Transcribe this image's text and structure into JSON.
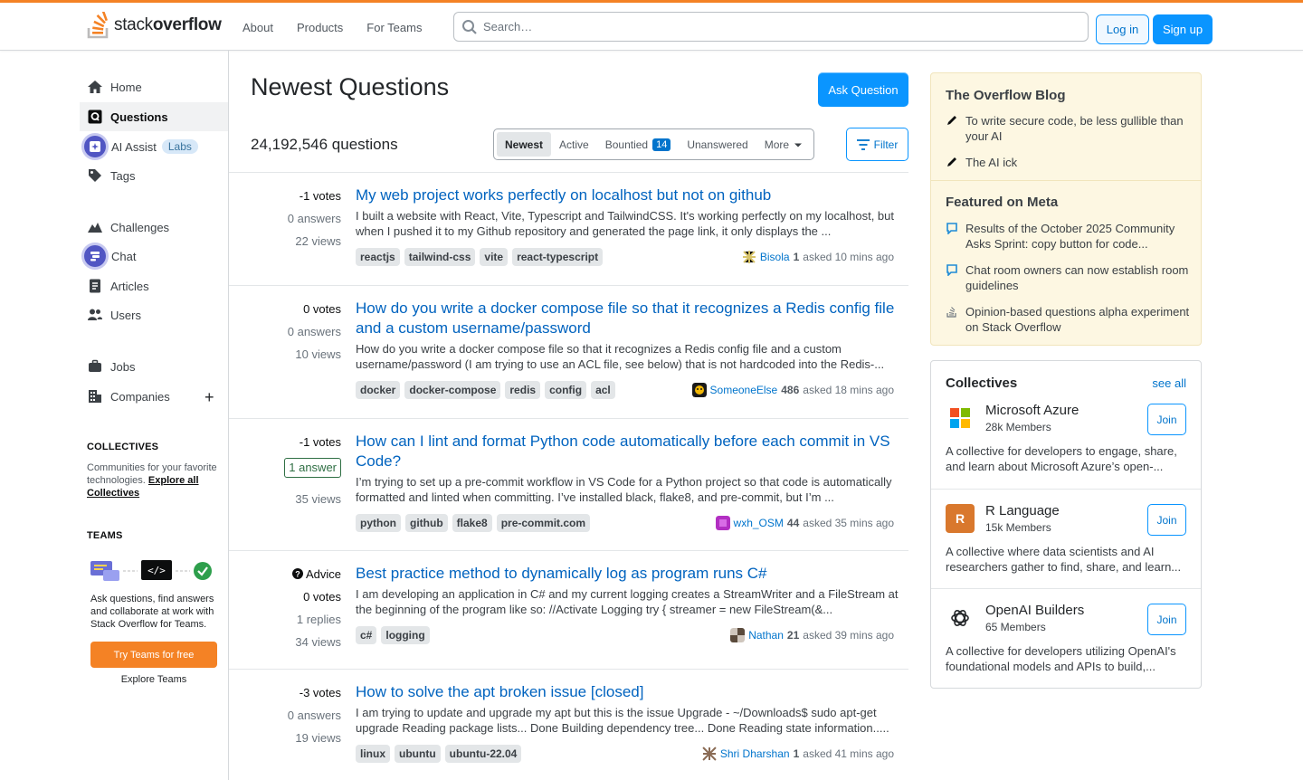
{
  "header": {
    "logo_text_light": "stack",
    "logo_text_bold": "overflow",
    "nav": [
      "About",
      "Products",
      "For Teams"
    ],
    "search_placeholder": "Search…",
    "login": "Log in",
    "signup": "Sign up",
    "accent": "#f48225"
  },
  "sidebar": {
    "items": [
      {
        "label": "Home",
        "icon": "home-icon"
      },
      {
        "label": "Questions",
        "icon": "questions-icon",
        "active": true
      },
      {
        "label": "AI Assist",
        "icon": "ai-assist-icon",
        "badge": "Labs"
      },
      {
        "label": "Tags",
        "icon": "tag-icon"
      },
      {
        "label": "Challenges",
        "icon": "challenges-icon"
      },
      {
        "label": "Chat",
        "icon": "chat-icon"
      },
      {
        "label": "Articles",
        "icon": "articles-icon"
      },
      {
        "label": "Users",
        "icon": "users-icon"
      },
      {
        "label": "Jobs",
        "icon": "jobs-icon"
      },
      {
        "label": "Companies",
        "icon": "companies-icon"
      }
    ],
    "collectives_heading": "COLLECTIVES",
    "collectives_text": "Communities for your favorite technologies.",
    "collectives_link": "Explore all Collectives",
    "teams_heading": "TEAMS",
    "teams_text": "Ask questions, find answers and collaborate at work with Stack Overflow for Teams.",
    "teams_button": "Try Teams for free",
    "teams_explore": "Explore Teams"
  },
  "main": {
    "title": "Newest Questions",
    "ask_button": "Ask Question",
    "count": "24,192,546 questions",
    "tabs": [
      {
        "label": "Newest",
        "active": true
      },
      {
        "label": "Active"
      },
      {
        "label": "Bountied",
        "badge": "14"
      },
      {
        "label": "Unanswered"
      },
      {
        "label": "More"
      }
    ],
    "filter": "Filter",
    "questions": [
      {
        "votes": "-1 votes",
        "answers": "0 answers",
        "views": "22 views",
        "title": "My web project works perfectly on localhost but not on github",
        "excerpt": "I built a website with React, Vite, Typescript and TailwindCSS. It's working perfectly on my localhost, but when I pushed it to my Github repository and generated the page link, it only displays the ...",
        "tags": [
          "reactjs",
          "tailwind-css",
          "vite",
          "react-typescript"
        ],
        "user": "Bisola",
        "rep": "1",
        "time": "asked 10 mins ago",
        "avatar_color": "#d8c46a"
      },
      {
        "votes": "0 votes",
        "answers": "0 answers",
        "views": "10 views",
        "title": "How do you write a docker compose file so that it recognizes a Redis config file and a custom username/password",
        "excerpt": "How do you write a docker compose file so that it recognizes a Redis config file and a custom username/password (I am trying to use an ACL file, see below) that is not hardcoded into the Redis-...",
        "tags": [
          "docker",
          "docker-compose",
          "redis",
          "config",
          "acl"
        ],
        "user": "SomeoneElse",
        "rep": "486",
        "time": "asked 18 mins ago",
        "avatar_color": "#1a1a1a"
      },
      {
        "votes": "-1 votes",
        "answers": "1 answer",
        "answered": true,
        "views": "35 views",
        "title": "How can I lint and format Python code automatically before each commit in VS Code?",
        "excerpt": "I’m trying to set up a pre-commit workflow in VS Code for a Python project so that code is automatically formatted and linted when committing. I’ve installed black, flake8, and pre-commit, but I’m ...",
        "tags": [
          "python",
          "github",
          "flake8",
          "pre-commit.com"
        ],
        "user": "wxh_OSM",
        "rep": "44",
        "time": "asked 35 mins ago",
        "avatar_color": "#b22fc2"
      },
      {
        "advice": "Advice",
        "votes": "0 votes",
        "answers": "1 replies",
        "views": "34 views",
        "title": "Best practice method to dynamically log as program runs C#",
        "excerpt": "I am developing an application in C# and my current logging creates a StreamWriter and a FileStream at the beginning of the program like so: //Activate Logging try { streamer = new FileStream(&...",
        "tags": [
          "c#",
          "logging"
        ],
        "user": "Nathan",
        "rep": "21",
        "time": "asked 39 mins ago",
        "avatar_color": "#5a4a3c"
      },
      {
        "votes": "-3 votes",
        "answers": "0 answers",
        "views": "19 views",
        "title": "How to solve the apt broken issue [closed]",
        "excerpt": "I am trying to update and upgrade my apt but this is the issue Upgrade - ~/Downloads$ sudo apt-get upgrade Reading package lists... Done Building dependency tree... Done Reading state information.....",
        "tags": [
          "linux",
          "ubuntu",
          "ubuntu-22.04"
        ],
        "user": "Shri Dharshan",
        "rep": "1",
        "time": "asked 41 mins ago",
        "avatar_color": "#8a6b55"
      }
    ]
  },
  "right": {
    "blog_heading": "The Overflow Blog",
    "blog_items": [
      "To write secure code, be less gullible than your AI",
      "The AI ick"
    ],
    "meta_heading": "Featured on Meta",
    "meta_items": [
      "Results of the October 2025 Community Asks Sprint: copy button for code...",
      "Chat room owners can now establish room guidelines",
      "Opinion-based questions alpha experiment on Stack Overflow"
    ],
    "collectives_heading": "Collectives",
    "see_all": "see all",
    "collectives": [
      {
        "name": "Microsoft Azure",
        "members": "28k Members",
        "join": "Join",
        "desc": "A collective for developers to engage, share, and learn about Microsoft Azure’s open-..."
      },
      {
        "name": "R Language",
        "members": "15k Members",
        "join": "Join",
        "desc": "A collective where data scientists and AI researchers gather to find, share, and learn...",
        "logo_letter": "R"
      },
      {
        "name": "OpenAI Builders",
        "members": "65 Members",
        "join": "Join",
        "desc": "A collective for developers utilizing OpenAI's foundational models and APIs to build,..."
      }
    ]
  }
}
